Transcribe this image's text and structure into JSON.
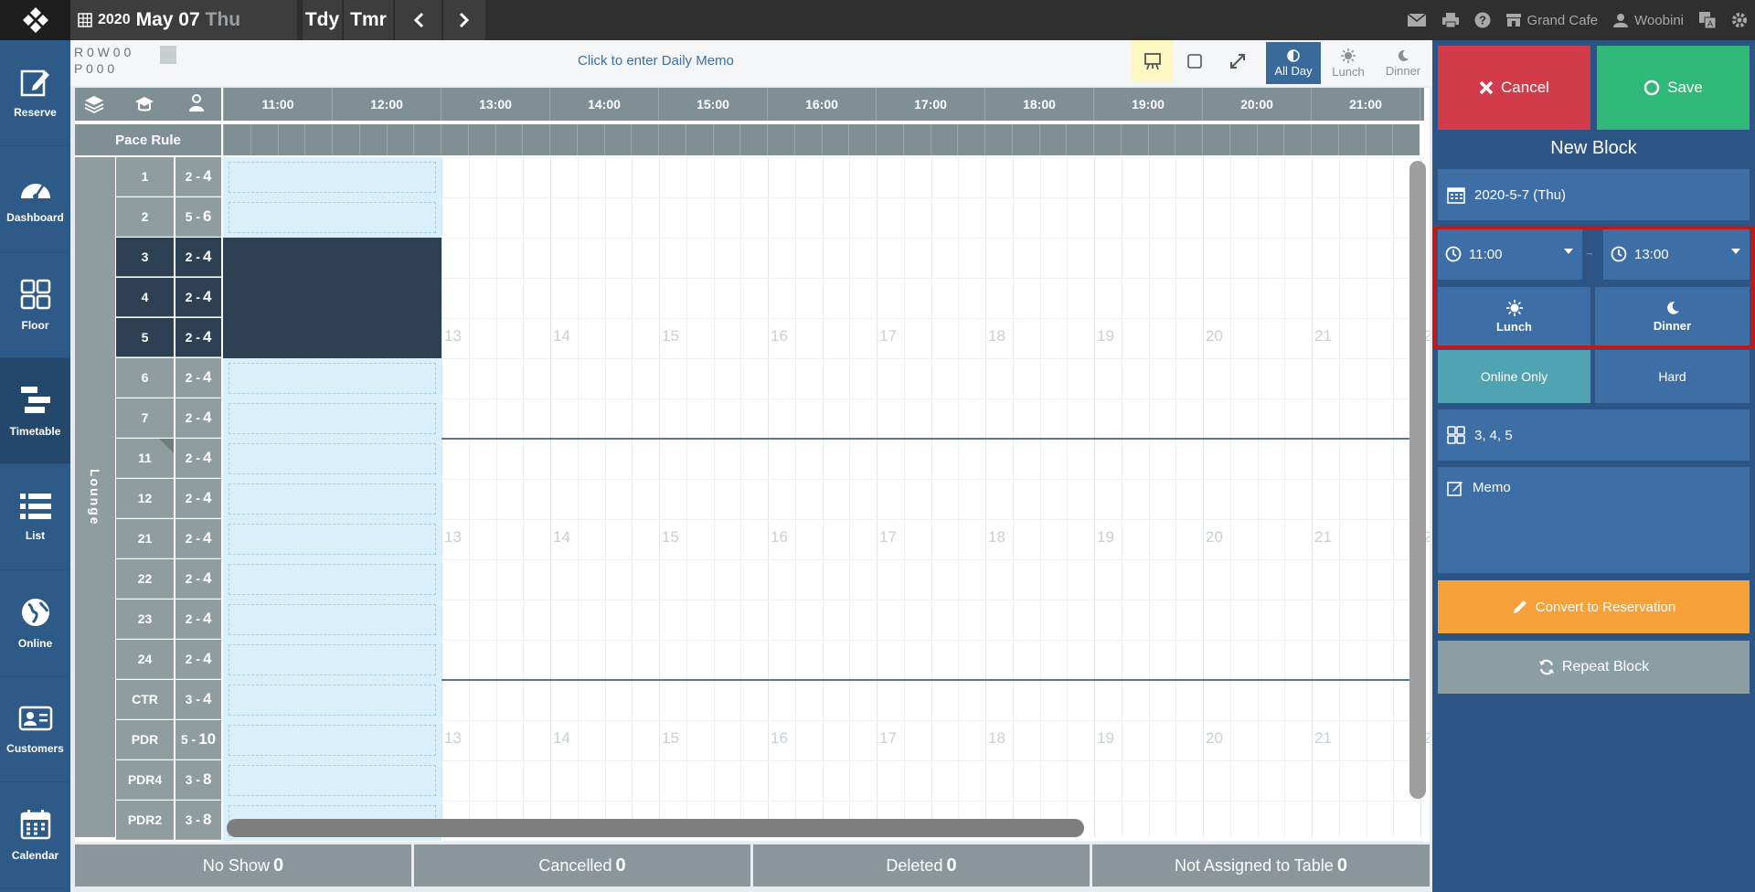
{
  "topbar": {
    "year": "2020",
    "month_day": "May 07",
    "weekday": "Thu",
    "today_label": "Tdy",
    "tomorrow_label": "Tmr",
    "venue": "Grand Cafe",
    "user": "Woobini"
  },
  "nav": [
    {
      "label": "Reserve",
      "icon": "reserve-icon"
    },
    {
      "label": "Dashboard",
      "icon": "dashboard-icon"
    },
    {
      "label": "Floor",
      "icon": "floor-icon"
    },
    {
      "label": "Timetable",
      "icon": "timetable-icon"
    },
    {
      "label": "List",
      "icon": "list-icon"
    },
    {
      "label": "Online",
      "icon": "globe-icon"
    },
    {
      "label": "Customers",
      "icon": "customers-icon"
    },
    {
      "label": "Calendar",
      "icon": "calendar-icon"
    }
  ],
  "memo": {
    "counts_row1": "R 0 W 0  0",
    "counts_row2": "P 0     0     0",
    "placeholder": "Click to enter Daily Memo",
    "all_day": "All Day",
    "lunch": "Lunch",
    "dinner": "Dinner"
  },
  "grid": {
    "pace_rule": "Pace Rule",
    "section": "Lounge",
    "times": [
      "11:00",
      "12:00",
      "13:00",
      "14:00",
      "15:00",
      "16:00",
      "17:00",
      "18:00",
      "19:00",
      "20:00",
      "21:00"
    ],
    "hour_markers": [
      "13",
      "14",
      "15",
      "16",
      "17",
      "18",
      "19",
      "20",
      "21",
      "2"
    ],
    "tables": [
      {
        "name": "1",
        "min": "2",
        "max": "4",
        "selected": false
      },
      {
        "name": "2",
        "min": "5",
        "max": "6",
        "selected": false
      },
      {
        "name": "3",
        "min": "2",
        "max": "4",
        "selected": true
      },
      {
        "name": "4",
        "min": "2",
        "max": "4",
        "selected": true
      },
      {
        "name": "5",
        "min": "2",
        "max": "4",
        "selected": true
      },
      {
        "name": "6",
        "min": "2",
        "max": "4",
        "selected": false
      },
      {
        "name": "7",
        "min": "2",
        "max": "4",
        "selected": false
      },
      {
        "name": "11",
        "min": "2",
        "max": "4",
        "selected": false
      },
      {
        "name": "12",
        "min": "2",
        "max": "4",
        "selected": false
      },
      {
        "name": "21",
        "min": "2",
        "max": "4",
        "selected": false
      },
      {
        "name": "22",
        "min": "2",
        "max": "4",
        "selected": false
      },
      {
        "name": "23",
        "min": "2",
        "max": "4",
        "selected": false
      },
      {
        "name": "24",
        "min": "2",
        "max": "4",
        "selected": false
      },
      {
        "name": "CTR",
        "min": "3",
        "max": "4",
        "selected": false
      },
      {
        "name": "PDR",
        "min": "5",
        "max": "10",
        "selected": false
      },
      {
        "name": "PDR4",
        "min": "3",
        "max": "8",
        "selected": false
      },
      {
        "name": "PDR2",
        "min": "3",
        "max": "8",
        "selected": false
      }
    ]
  },
  "bottom": [
    {
      "label": "No Show",
      "count": "0"
    },
    {
      "label": "Cancelled",
      "count": "0"
    },
    {
      "label": "Deleted",
      "count": "0"
    },
    {
      "label": "Not Assigned to Table",
      "count": "0"
    }
  ],
  "panel": {
    "cancel": "Cancel",
    "save": "Save",
    "title": "New Block",
    "date": "2020-5-7 (Thu)",
    "start_time": "11:00",
    "end_time": "13:00",
    "separator": "~",
    "lunch": "Lunch",
    "dinner": "Dinner",
    "online_only": "Online Only",
    "hard": "Hard",
    "tables": "3,  4,  5",
    "memo_placeholder": "Memo",
    "convert": "Convert to Reservation",
    "repeat": "Repeat Block"
  },
  "colors": {
    "nav_bg": "#2e5a88",
    "panel_bg": "#2c5585",
    "cancel": "#d23b49",
    "save": "#2fb878",
    "convert": "#f6a13a",
    "online_only_active": "#4fa3b3",
    "highlight_box": "#c0191c"
  }
}
